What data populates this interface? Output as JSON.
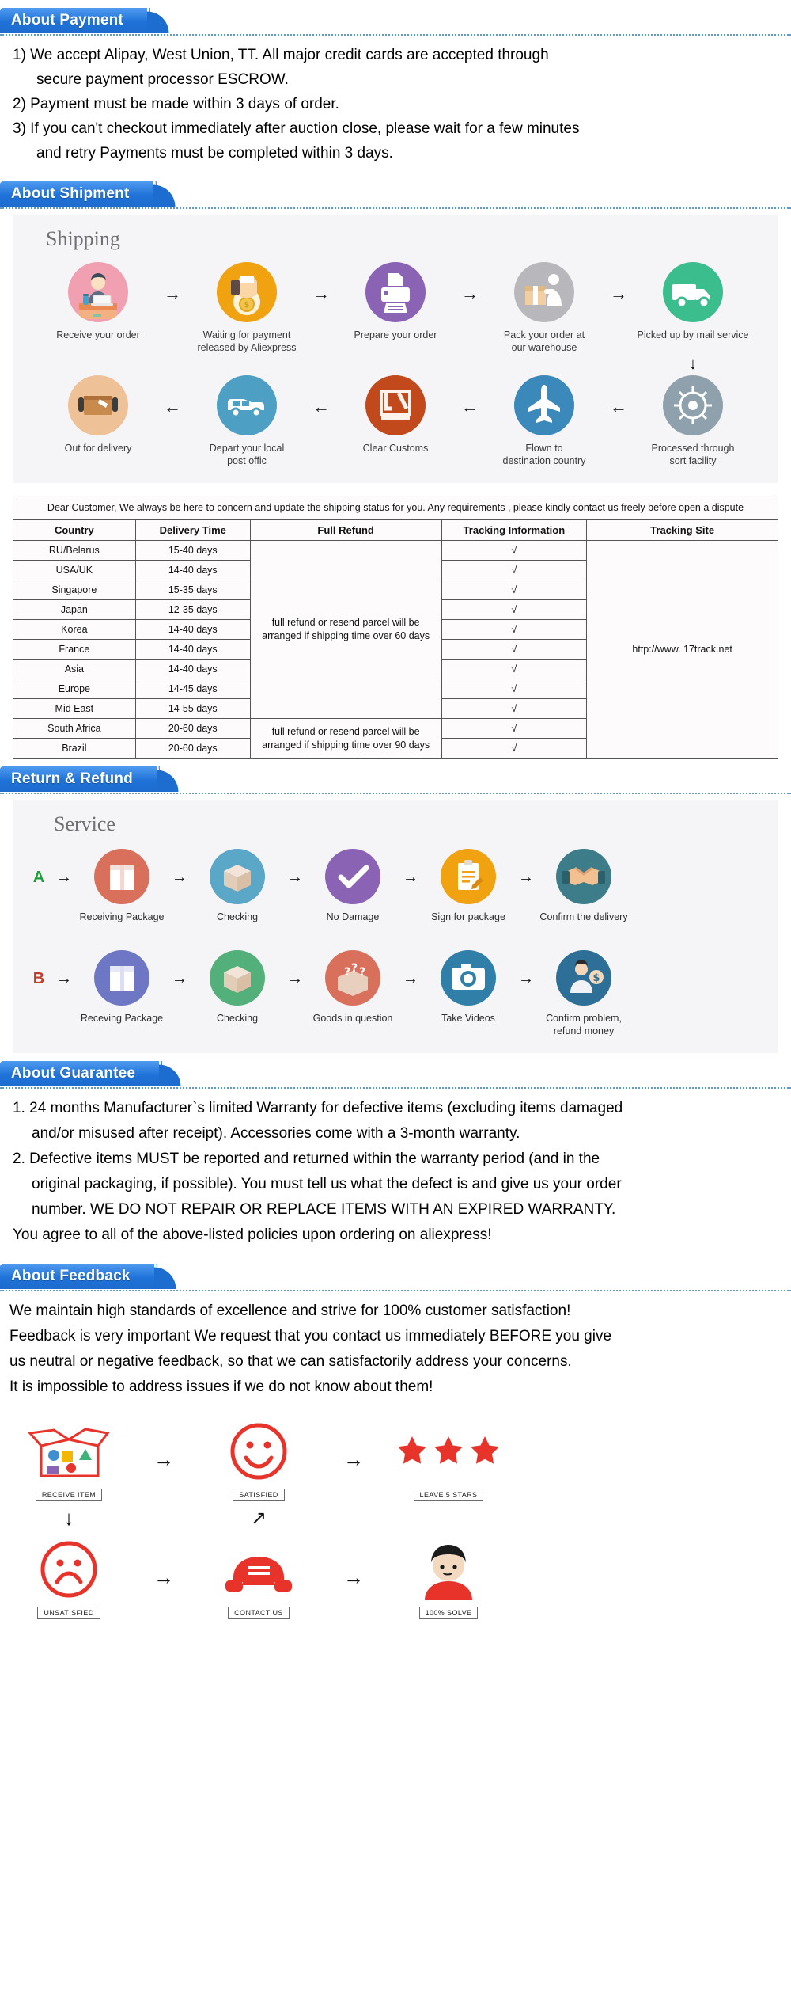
{
  "sections": {
    "payment": {
      "banner": "About Payment",
      "lines": [
        {
          "text": "1) We accept Alipay, West Union, TT. All major credit cards are accepted through",
          "indent": false
        },
        {
          "text": "secure payment processor ESCROW.",
          "indent": true
        },
        {
          "text": "2) Payment must be made within 3 days of order.",
          "indent": false
        },
        {
          "text": "3) If you can't checkout immediately after auction close, please wait for a few minutes",
          "indent": false
        },
        {
          "text": "and retry Payments must be completed within 3 days.",
          "indent": true
        }
      ]
    },
    "shipment": {
      "banner": "About Shipment",
      "flow_title": "Shipping",
      "row1": [
        {
          "label": "Receive your order",
          "icon": "person-at-desk-icon",
          "color": "#f0a0b0"
        },
        {
          "label": "Waiting for payment\nreleased by Aliexpress",
          "icon": "hand-with-coin-icon",
          "color": "#f0a211"
        },
        {
          "label": "Prepare your order",
          "icon": "printer-icon",
          "color": "#8b63b5"
        },
        {
          "label": "Pack your order at\nour warehouse",
          "icon": "worker-packing-icon",
          "color": "#b8b8bc"
        },
        {
          "label": "Picked up by mail service",
          "icon": "delivery-truck-icon",
          "color": "#3bbd8d"
        }
      ],
      "row2": [
        {
          "label": "Out for delivery",
          "icon": "package-handoff-icon",
          "color": "#efc197"
        },
        {
          "label": "Depart your local\npost offic",
          "icon": "van-icon",
          "color": "#4e9fc4"
        },
        {
          "label": "Clear  Customs",
          "icon": "customs-stamp-icon",
          "color": "#c1491b"
        },
        {
          "label": "Flown to\ndestination country",
          "icon": "airplane-icon",
          "color": "#3b88bb"
        },
        {
          "label": "Processed through\nsort facility",
          "icon": "sort-facility-icon",
          "color": "#8fa1ad"
        }
      ],
      "arrow_right": "→",
      "arrow_left": "←",
      "arrow_down": "↓",
      "table": {
        "notice": "Dear Customer, We always be here to concern and update the shipping status for you.  Any requirements , please kindly contact us freely before open a dispute",
        "headers": [
          "Country",
          "Delivery Time",
          "Full Refund",
          "Tracking Information",
          "Tracking Site"
        ],
        "rows": [
          {
            "country": "RU/Belarus",
            "time": "15-40 days",
            "track": "√"
          },
          {
            "country": "USA/UK",
            "time": "14-40 days",
            "track": "√"
          },
          {
            "country": "Singapore",
            "time": "15-35 days",
            "track": "√"
          },
          {
            "country": "Japan",
            "time": "12-35 days",
            "track": "√"
          },
          {
            "country": "Korea",
            "time": "14-40 days",
            "track": "√"
          },
          {
            "country": "France",
            "time": "14-40 days",
            "track": "√"
          },
          {
            "country": "Asia",
            "time": "14-40 days",
            "track": "√"
          },
          {
            "country": "Europe",
            "time": "14-45 days",
            "track": "√"
          },
          {
            "country": "Mid East",
            "time": "14-55 days",
            "track": "√"
          },
          {
            "country": "South Africa",
            "time": "20-60 days",
            "track": "√"
          },
          {
            "country": "Brazil",
            "time": "20-60 days",
            "track": "√"
          }
        ],
        "refund_60": "full refund or resend parcel will be arranged if shipping time over 60 days",
        "refund_90": "full refund or resend parcel will be arranged if shipping time over 90 days",
        "tracking_site": "http://www. 17track.net"
      }
    },
    "return_refund": {
      "banner": "Return & Refund",
      "service_title": "Service",
      "row_a_tag": "A",
      "row_b_tag": "B",
      "arrow": "→",
      "row_a": [
        {
          "label": "Receiving Package",
          "icon": "package-box-icon",
          "color": "#d9705c"
        },
        {
          "label": "Checking",
          "icon": "open-box-icon",
          "color": "#5aa7c8"
        },
        {
          "label": "No Damage",
          "icon": "check-mark-icon",
          "color": "#8b63b5"
        },
        {
          "label": "Sign for package",
          "icon": "clipboard-sign-icon",
          "color": "#f0a211"
        },
        {
          "label": "Confirm the delivery",
          "icon": "handshake-icon",
          "color": "#3c7d89"
        }
      ],
      "row_b": [
        {
          "label": "Receving Package",
          "icon": "package-box-icon",
          "color": "#6e77c4"
        },
        {
          "label": "Checking",
          "icon": "open-box-icon",
          "color": "#53b07a"
        },
        {
          "label": "Goods in question",
          "icon": "question-box-icon",
          "color": "#d9705c"
        },
        {
          "label": "Take Videos",
          "icon": "camera-icon",
          "color": "#2f7fa8"
        },
        {
          "label": "Confirm problem,\nrefund money",
          "icon": "refund-person-icon",
          "color": "#2d6f96"
        }
      ]
    },
    "guarantee": {
      "banner": "About Guarantee",
      "lines": [
        {
          "text": "1. 24 months Manufacturer`s limited Warranty for defective items (excluding items damaged",
          "indent": false
        },
        {
          "text": "and/or misused after receipt). Accessories come with a 3-month warranty.",
          "indent": true
        },
        {
          "text": "2. Defective items MUST be reported and returned within the warranty period (and in the",
          "indent": false
        },
        {
          "text": "original packaging, if possible). You must tell us what the defect is and give us your order",
          "indent": true
        },
        {
          "text": "number. WE DO NOT REPAIR OR REPLACE ITEMS WITH AN EXPIRED WARRANTY.",
          "indent": true
        },
        {
          "text": "You agree to all of the above-listed policies upon ordering on aliexpress!",
          "indent": false
        }
      ]
    },
    "feedback": {
      "banner": "About Feedback",
      "lines": [
        "We maintain high standards of excellence and strive for 100% customer satisfaction!",
        "Feedback is very important We request that you contact us immediately BEFORE you give",
        "us neutral or negative feedback, so that we can satisfactorily address your concerns.",
        "It is impossible to address issues if we do not know about them!"
      ],
      "graphic": {
        "arrow": "→",
        "arrow_diag": "↗",
        "arrow_down": "↓",
        "cells": [
          {
            "caption": "RECEIVE ITEM",
            "icon": "open-carton-icon"
          },
          {
            "caption": "SATISFIED",
            "icon": "smiley-face-icon"
          },
          {
            "caption": "LEAVE 5 STARS",
            "icon": "three-stars-icon"
          },
          {
            "caption": "UNSATISFIED",
            "icon": "sad-face-icon"
          },
          {
            "caption": "CONTACT US",
            "icon": "telephone-icon"
          },
          {
            "caption": "100% SOLVE",
            "icon": "support-person-icon"
          }
        ]
      }
    }
  },
  "colors": {
    "banner_blue": "#1f72d8",
    "dotted_line": "#5b9bd5",
    "panel_bg": "#f5f5f7",
    "feedback_red": "#e8332a"
  }
}
